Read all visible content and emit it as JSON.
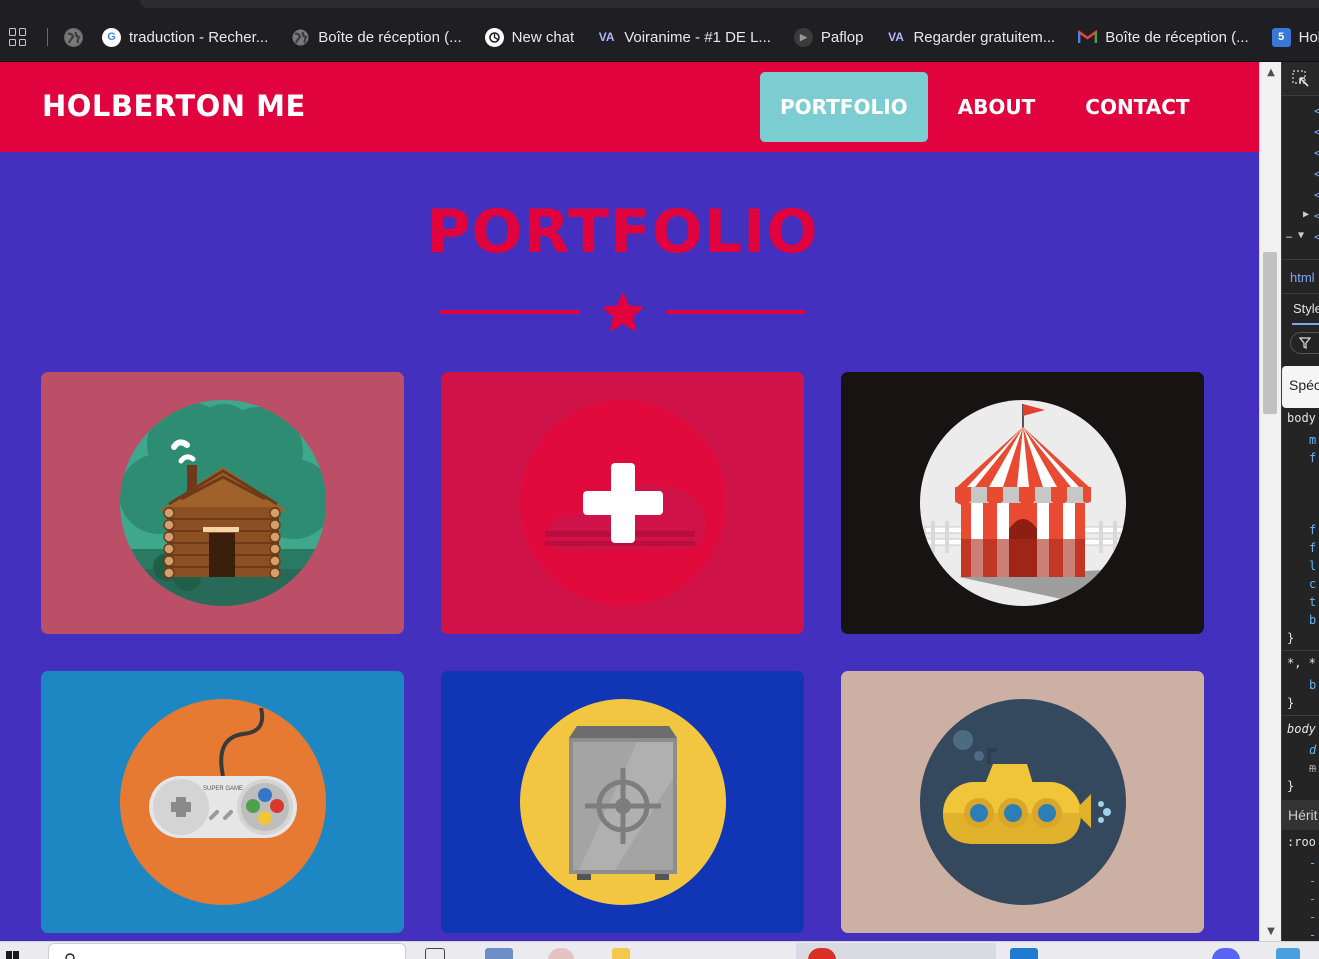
{
  "bookmarks": [
    {
      "label": "traduction - Recher...",
      "icon": "google-icon"
    },
    {
      "label": "Boîte de réception (...",
      "icon": "globe-icon"
    },
    {
      "label": "New chat",
      "icon": "chatgpt-icon"
    },
    {
      "label": "Voiranime - #1 DE L...",
      "icon": "voiranime-icon"
    },
    {
      "label": "Paflop",
      "icon": "play-icon"
    },
    {
      "label": "Regarder gratuitem...",
      "icon": "voiranime-icon"
    },
    {
      "label": "Boîte de réception (...",
      "icon": "gmail-icon"
    },
    {
      "label": "Hol",
      "icon": "calendar-icon"
    }
  ],
  "site": {
    "brand": "HOLBERTON ME",
    "nav": [
      {
        "label": "PORTFOLIO",
        "active": true
      },
      {
        "label": "ABOUT",
        "active": false
      },
      {
        "label": "CONTACT",
        "active": false
      }
    ],
    "heading": "PORTFOLIO"
  },
  "portfolio": [
    {
      "image": "cabin-icon",
      "bg": "#bb4f68"
    },
    {
      "image": "ambulance-icon",
      "bg": "#cf1349"
    },
    {
      "image": "circus-tent-icon",
      "bg": "#171313"
    },
    {
      "image": "game-controller-icon",
      "bg": "#1d87c4",
      "label": "SUPER GAME"
    },
    {
      "image": "safe-icon",
      "bg": "#1035b5"
    },
    {
      "image": "submarine-icon",
      "bg": "#cdb0a4"
    }
  ],
  "colors": {
    "accent": "#e0033e",
    "page_bg": "#4330be",
    "active_nav": "#7bcdd1"
  },
  "devtools": {
    "tab_html": "html",
    "tab_styles": "Style",
    "specificity": "Spéc",
    "rule1": "body",
    "rule2": "*, *",
    "rule3": "body",
    "inherited": "Hérit",
    "root": ":roo"
  }
}
